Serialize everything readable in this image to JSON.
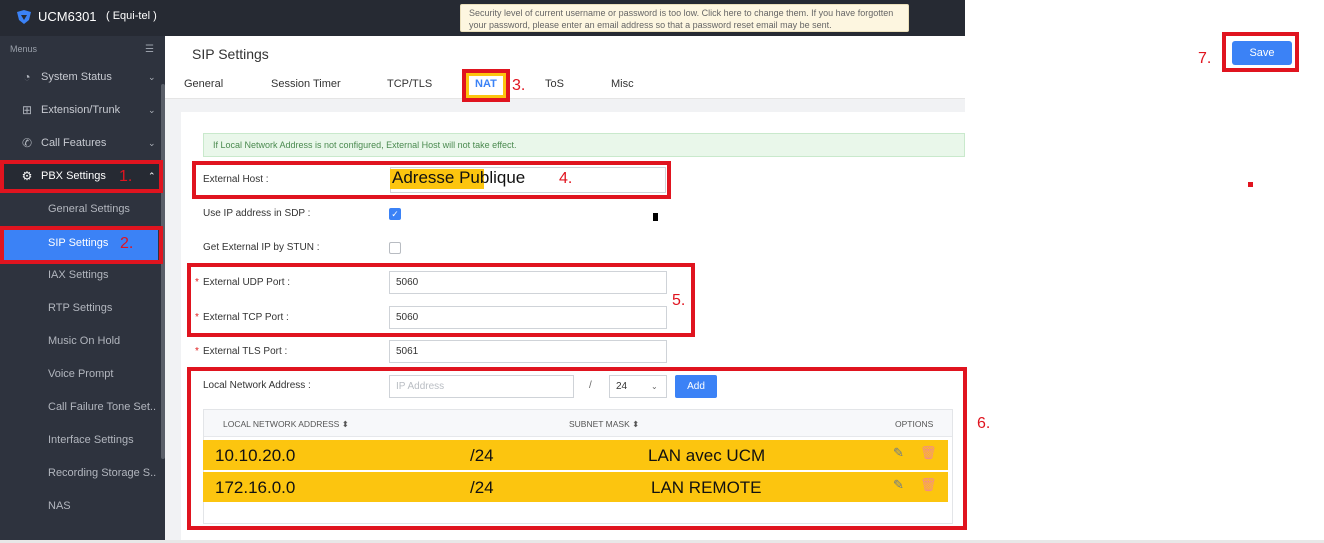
{
  "app": {
    "name": "UCM6301",
    "subtitle": "( Equi-tel )"
  },
  "security_note": "Security level of current username or password is too low. Click here to change them. If you have forgotten your password, please enter an email address so that a password reset email may be sent.",
  "sidebar": {
    "menus_label": "Menus",
    "items": [
      {
        "label": "System Status",
        "icon": "gauge-icon"
      },
      {
        "label": "Extension/Trunk",
        "icon": "network-icon"
      },
      {
        "label": "Call Features",
        "icon": "phone-icon"
      },
      {
        "label": "PBX Settings",
        "icon": "gear-icon"
      }
    ],
    "sub_items": [
      "General Settings",
      "SIP Settings",
      "IAX Settings",
      "RTP Settings",
      "Music On Hold",
      "Voice Prompt",
      "Call Failure Tone Set...",
      "Interface Settings",
      "Recording Storage S...",
      "NAS"
    ]
  },
  "page": {
    "title": "SIP Settings",
    "tabs": [
      "General",
      "Session Timer",
      "TCP/TLS",
      "NAT",
      "ToS",
      "Misc"
    ],
    "active_tab": "NAT",
    "save_label": "Save"
  },
  "form": {
    "notice": "If Local Network Address is not configured, External Host will not take effect.",
    "external_host_label": "External Host :",
    "external_host_value": "Adresse Publique",
    "use_ip_sdp_label": "Use IP address in SDP :",
    "use_ip_sdp_checked": true,
    "stun_label": "Get External IP by STUN :",
    "stun_checked": false,
    "udp_port_label": "External UDP Port :",
    "udp_port_value": "5060",
    "tcp_port_label": "External TCP Port :",
    "tcp_port_value": "5060",
    "tls_port_label": "External TLS Port :",
    "tls_port_value": "5061",
    "local_network_label": "Local Network Address :",
    "ip_placeholder": "IP Address",
    "slash": "/",
    "mask_value": "24",
    "add_label": "Add"
  },
  "table": {
    "headers": [
      "LOCAL NETWORK ADDRESS ⬍",
      "SUBNET MASK ⬍",
      "OPTIONS"
    ],
    "rows": [
      {
        "address": "10.10.20.0",
        "mask": "/24",
        "note": "LAN avec UCM"
      },
      {
        "address": "172.16.0.0",
        "mask": "/24",
        "note": "LAN REMOTE"
      }
    ]
  },
  "annotations": [
    "1.",
    "2.",
    "3.",
    "4.",
    "5.",
    "6.",
    "7."
  ],
  "colors": {
    "accent": "#3b82f6",
    "highlight": "#fcc50f",
    "annotation_red": "#e0141f",
    "sidebar_bg": "#2e333e"
  }
}
